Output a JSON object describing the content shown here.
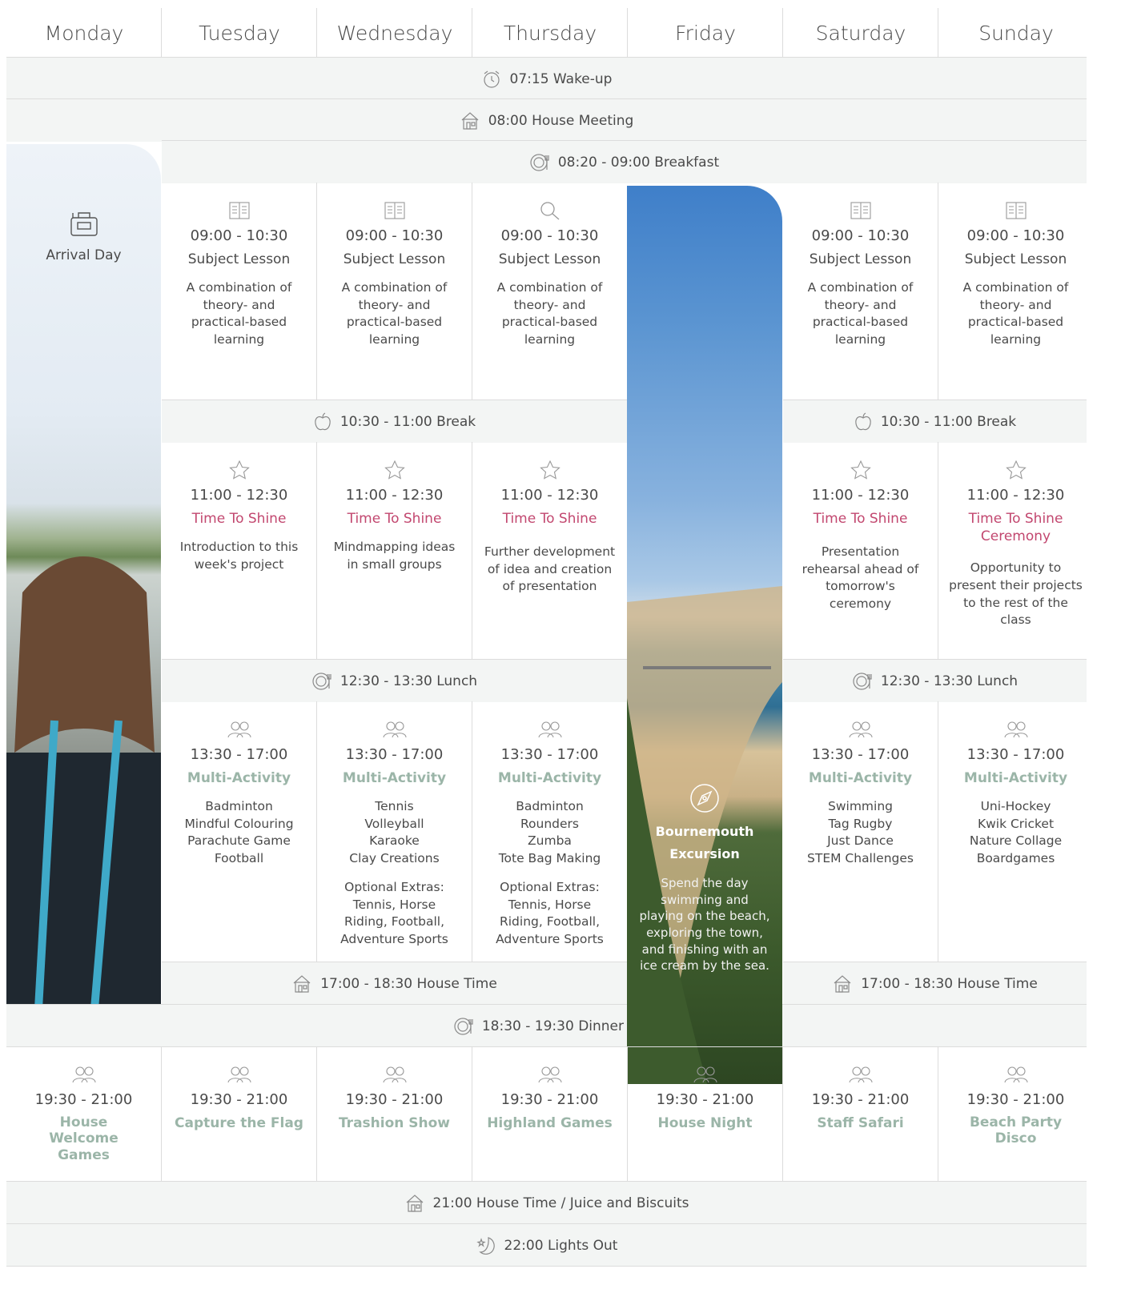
{
  "days": [
    "Monday",
    "Tuesday",
    "Wednesday",
    "Thursday",
    "Friday",
    "Saturday",
    "Sunday"
  ],
  "bands": {
    "wakeup": "07:15  Wake-up",
    "meeting": "08:00  House Meeting",
    "breakfast": "08:20 - 09:00  Breakfast",
    "break_left": "10:30 - 11:00 Break",
    "break_right": "10:30 - 11:00 Break",
    "lunch_left": "12:30 - 13:30  Lunch",
    "lunch_right": "12:30 - 13:30  Lunch",
    "housetime_left": "17:00 - 18:30  House Time",
    "housetime_right": "17:00 - 18:30  House Time",
    "dinner": "18:30 - 19:30  Dinner",
    "juice": "21:00 House Time /  Juice and Biscuits",
    "lights": "22:00  Lights Out"
  },
  "monday": {
    "arrival": "Arrival Day"
  },
  "friday": {
    "title_line1": "Bournemouth",
    "title_line2": "Excursion",
    "desc": "Spend the day swimming and playing on the beach, exploring the town, and finishing with an ice cream by the sea."
  },
  "lessons": {
    "time": "09:00 - 10:30",
    "title": "Subject Lesson",
    "desc": "A combination of theory- and practical-based learning"
  },
  "shine": {
    "time": "11:00 - 12:30",
    "tuesday": {
      "title": "Time To Shine",
      "desc": "Introduction to this week's project"
    },
    "wednesday": {
      "title": "Time To Shine",
      "desc": "Mindmapping ideas in small groups"
    },
    "thursday": {
      "title": "Time To Shine",
      "desc": "Further development of idea and creation of presentation"
    },
    "saturday": {
      "title": "Time To Shine",
      "desc": "Presentation rehearsal ahead of tomorrow's ceremony"
    },
    "sunday": {
      "title": "Time To Shine Ceremony",
      "desc": "Opportunity to present their projects to the rest of the class"
    }
  },
  "multi": {
    "time": "13:30 - 17:00",
    "title": "Multi-Activity",
    "tuesday": [
      "Badminton",
      "Mindful Colouring",
      "Parachute Game",
      "Football"
    ],
    "wednesday": [
      "Tennis",
      "Volleyball",
      "Karaoke",
      "Clay Creations"
    ],
    "thursday": [
      "Badminton",
      "Rounders",
      "Zumba",
      "Tote Bag Making"
    ],
    "saturday": [
      "Swimming",
      "Tag Rugby",
      "Just Dance",
      "STEM Challenges"
    ],
    "sunday": [
      "Uni-Hockey",
      "Kwik Cricket",
      "Nature Collage",
      "Boardgames"
    ],
    "extras": "Optional Extras: Tennis, Horse Riding, Football, Adventure Sports"
  },
  "evening": {
    "time": "19:30 - 21:00",
    "monday": "House Welcome Games",
    "tuesday": "Capture the Flag",
    "wednesday": "Trashion Show",
    "thursday": "Highland Games",
    "friday": "House Night",
    "saturday": "Staff Safari",
    "sunday": "Beach Party Disco"
  },
  "colors": {
    "band_bg": "#f3f5f4",
    "pink": "#c2476f",
    "green": "#9bb5a8",
    "line": "#dcdcdc"
  }
}
